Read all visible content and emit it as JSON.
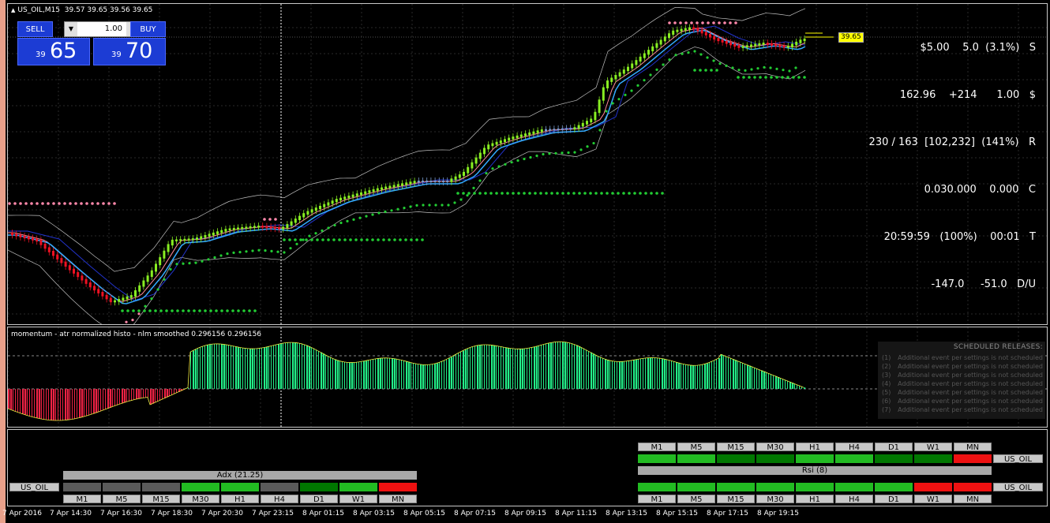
{
  "chart_title": {
    "symbol": "US_OIL,M15",
    "ohlc": "39.57 39.65 39.56 39.65"
  },
  "trade_panel": {
    "sell_label": "SELL",
    "buy_label": "BUY",
    "lot_value": "1.00",
    "bid_small": "39",
    "bid_big": "65",
    "ask_small": "39",
    "ask_big": "70"
  },
  "info_panel": {
    "lines": [
      "$5.00    5.0  (3.1%)   S",
      "162.96    +214      1.00   $",
      "230 / 163  [102,232]  (141%)   R",
      "0.030.000    0.000   C",
      "20:59:59   (100%)    00:01   T",
      "-147.0     -51.0   D/U"
    ]
  },
  "price_tag": "39.65",
  "indicator": {
    "title": "momentum - atr normalized histo - nlm smoothed 0.296156 0.296156"
  },
  "scheduled": {
    "header": "SCHEDULED RELEASES:",
    "rows": [
      {
        "num": "(1)",
        "text": "Additional event per settings is not scheduled"
      },
      {
        "num": "(2)",
        "text": "Additional event per settings is not scheduled"
      },
      {
        "num": "(3)",
        "text": "Additional event per settings is not scheduled"
      },
      {
        "num": "(4)",
        "text": "Additional event per settings is not scheduled"
      },
      {
        "num": "(5)",
        "text": "Additional event per settings is not scheduled"
      },
      {
        "num": "(6)",
        "text": "Additional event per settings is not scheduled"
      },
      {
        "num": "(7)",
        "text": "Additional event per settings is not scheduled"
      }
    ]
  },
  "dashboard": {
    "timeframes": [
      "M1",
      "M5",
      "M15",
      "M30",
      "H1",
      "H4",
      "D1",
      "W1",
      "MN"
    ],
    "symbol": "US_OIL",
    "adx_label": "Adx (21.25)",
    "rsi_label": "Rsi (8)",
    "adx_colors": [
      "#5a5a5a",
      "#5a5a5a",
      "#5a5a5a",
      "#22bb22",
      "#22bb22",
      "#5a5a5a",
      "#007700",
      "#22bb22",
      "#ee1111"
    ],
    "rsi_top_colors": [
      "#22bb22",
      "#22bb22",
      "#007700",
      "#007700",
      "#22bb22",
      "#22bb22",
      "#007700",
      "#007700",
      "#ee1111"
    ],
    "rsi_bottom_colors": [
      "#22bb22",
      "#22bb22",
      "#22bb22",
      "#22bb22",
      "#22bb22",
      "#22bb22",
      "#22bb22",
      "#ee1111",
      "#ee1111"
    ]
  },
  "time_axis": [
    "7 Apr 2016",
    "7 Apr 14:30",
    "7 Apr 16:30",
    "7 Apr 18:30",
    "7 Apr 20:30",
    "7 Apr 23:15",
    "8 Apr 01:15",
    "8 Apr 03:15",
    "8 Apr 05:15",
    "8 Apr 07:15",
    "8 Apr 09:15",
    "8 Apr 11:15",
    "8 Apr 13:15",
    "8 Apr 15:15",
    "8 Apr 17:15",
    "8 Apr 19:15"
  ],
  "colors": {
    "bull_candle": "#88ee22",
    "bear_candle": "#ee1122",
    "neutral_candle": "#7799cc",
    "histo_up": "#22ee88",
    "histo_down": "#ee2244",
    "ma_fast": "#33aaff",
    "ma_slow": "#2233cc",
    "band": "#c0c0c0",
    "dots_up": "#22cc33",
    "dots_down": "#ff88aa"
  }
}
